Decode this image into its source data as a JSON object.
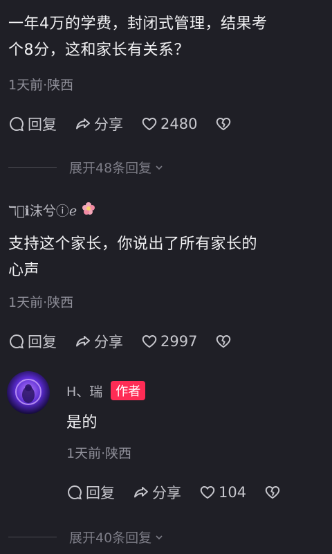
{
  "comment1": {
    "text_line1": "一年4万的学费，封闭式管理，结果考",
    "text_line2": "个8分，这和家长有关系？",
    "meta": "1天前·陕西",
    "reply_label": "回复",
    "share_label": "分享",
    "likes": "2480"
  },
  "expand1": {
    "label": "展开48条回复"
  },
  "comment2": {
    "username": "ℸ᷊ℹ沫兮ⓘℯ",
    "text_line1": "支持这个家长，你说出了所有家长的",
    "text_line2": "心声",
    "meta": "1天前·陕西",
    "reply_label": "回复",
    "share_label": "分享",
    "likes": "2997"
  },
  "reply1": {
    "username": "H、瑞",
    "badge": "作者",
    "text": "是的",
    "meta": "1天前·陕西",
    "reply_label": "回复",
    "share_label": "分享",
    "likes": "104"
  },
  "expand2": {
    "label": "展开40条回复"
  },
  "colors": {
    "background": "#1f1f26",
    "author_badge": "#fe2c55",
    "meta_text": "#8f8f99"
  }
}
